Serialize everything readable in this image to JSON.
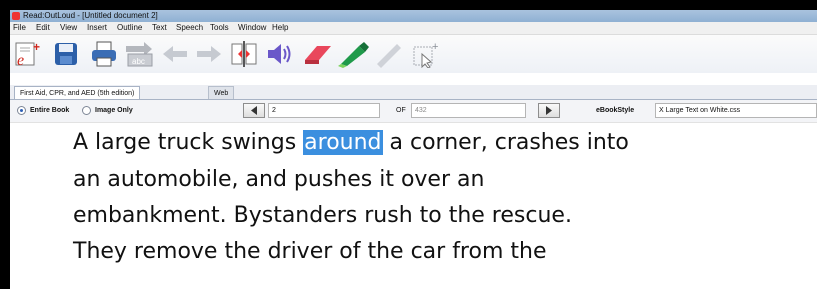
{
  "window": {
    "title": "Read:OutLoud - [Untitled document 2]"
  },
  "menu": {
    "items": [
      "File",
      "Edit",
      "View",
      "Insert",
      "Outline",
      "Text",
      "Speech",
      "Tools",
      "Window",
      "Help"
    ]
  },
  "toolbar": {
    "buttons": [
      "new-ebook-icon",
      "save-icon",
      "print-icon",
      "convert-abc-icon",
      "back-arrow-icon",
      "forward-arrow-icon",
      "split-page-icon",
      "speaker-icon",
      "eraser-icon",
      "green-highlighter-icon",
      "highlighter-pen-icon",
      "extract-text-icon"
    ]
  },
  "tabs": [
    {
      "label": "First Aid, CPR, and AED (5th edition)",
      "active": true
    },
    {
      "label": "Web",
      "active": false
    }
  ],
  "navigation": {
    "mode_entire_book_label": "Entire Book",
    "mode_image_only_label": "Image Only",
    "selected_mode": "Entire Book",
    "page_value": "2",
    "of_label": "OF",
    "total_pages": "432",
    "ebook_style_label": "eBookStyle",
    "ebook_style_value": "X Large Text on White.css"
  },
  "reader": {
    "line1_before": "A large truck swings ",
    "highlighted_word": "around",
    "line1_after": " a corner, crashes into",
    "line2": "an automobile, and pushes it over an",
    "line3": "embankment. Bystanders rush to the rescue.",
    "line4": "They remove the driver of the car from the"
  },
  "colors": {
    "highlight": "#3b8fdf",
    "titlebar": "#a9c3de",
    "text": "#111111"
  }
}
